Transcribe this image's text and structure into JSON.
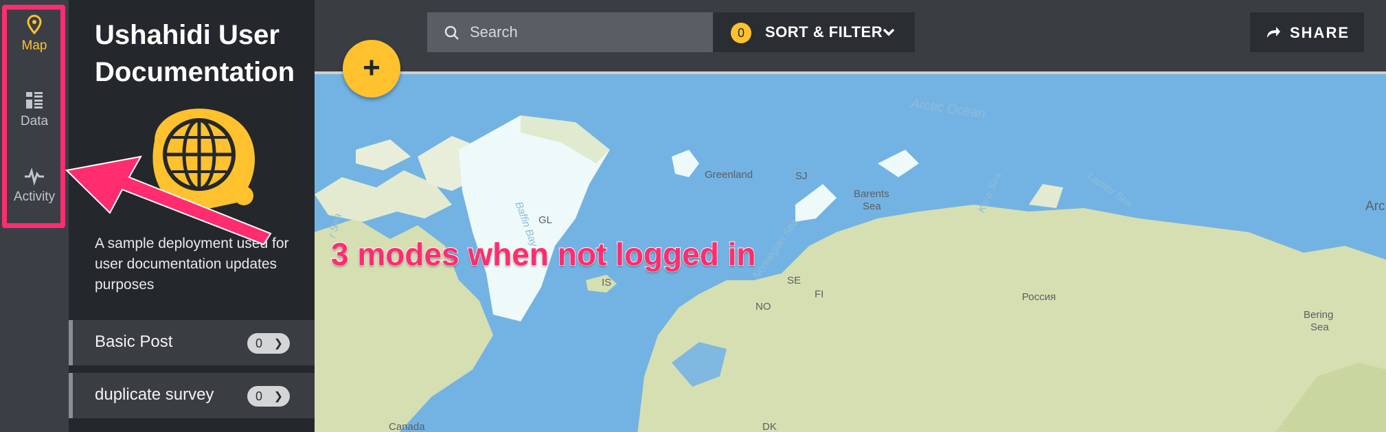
{
  "sidebar": {
    "modes": [
      {
        "label": "Map",
        "icon": "map-pin-icon",
        "active": true
      },
      {
        "label": "Data",
        "icon": "data-list-icon",
        "active": false
      },
      {
        "label": "Activity",
        "icon": "activity-pulse-icon",
        "active": false
      }
    ]
  },
  "deployment": {
    "title_line1": "Ushahidi User",
    "title_line2": "Documentation",
    "description": "A sample deployment used for user documentation updates purposes"
  },
  "surveys": [
    {
      "label": "Basic Post",
      "count": "0"
    },
    {
      "label": "duplicate survey",
      "count": "0"
    }
  ],
  "toolbar": {
    "search_placeholder": "Search",
    "filter_count": "0",
    "sort_filter_label": "SORT & FILTER",
    "share_label": "SHARE"
  },
  "fab_label": "+",
  "annotation": "3 modes when not logged in",
  "map": {
    "labels": {
      "arctic_ocean": "Arctic Ocean",
      "greenland": "Greenland",
      "sj": "SJ",
      "barents_1": "Barents",
      "barents_2": "Sea",
      "kara_sea": "Kara Sea",
      "laptev_sea": "Laptev Sea",
      "baffin_bay": "Baffin Bay",
      "labrador_sea": "r Sea",
      "gl": "GL",
      "norwegian_sea": "Norwegian Sea",
      "is": "IS",
      "se": "SE",
      "fi": "FI",
      "no": "NO",
      "dk": "DK",
      "russia": "Россия",
      "canada": "Canada",
      "bering_1": "Bering",
      "bering_2": "Sea",
      "arc": "Arc"
    }
  },
  "colors": {
    "accent": "#ffc12e",
    "annotation": "#ff2d6f",
    "ocean": "#73b3e3",
    "land": "#d6dfb2",
    "ice": "#eefaf9"
  }
}
